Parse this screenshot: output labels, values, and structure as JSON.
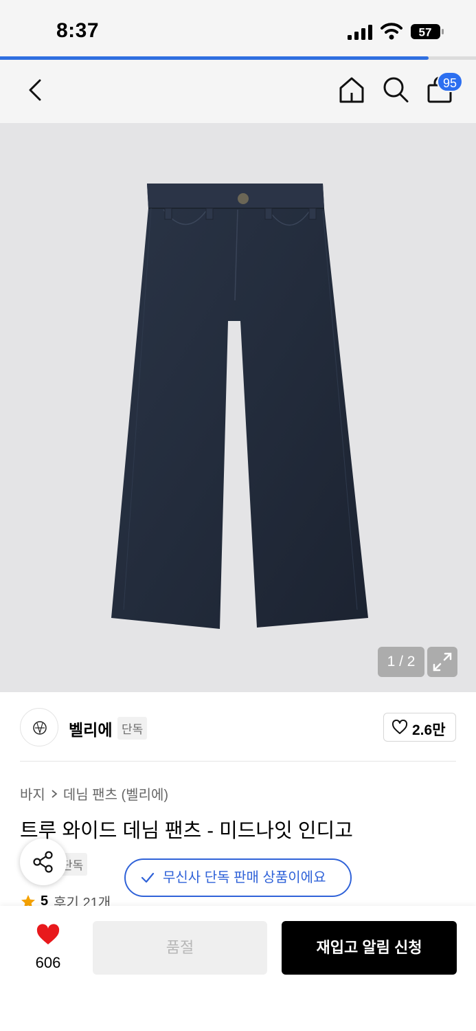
{
  "status_bar": {
    "time": "8:37",
    "battery": "57"
  },
  "page_progress": 0.9,
  "header": {
    "cart_count": "95"
  },
  "gallery": {
    "counter": "1 / 2"
  },
  "brand": {
    "name": "벨리에",
    "tag": "단독",
    "likes": "2.6만"
  },
  "breadcrumb": {
    "category": "바지",
    "subcategory": "데님 팬츠 (벨리에)"
  },
  "product": {
    "title": "트루 와이드 데님 팬츠 - 미드나잇 인디고",
    "tag": "단독",
    "rating": "5",
    "reviews": "후기 21개"
  },
  "toast": {
    "text": "무신사 단독 판매 상품이에요"
  },
  "bottom_bar": {
    "wish_count": "606",
    "soldout_label": "품절",
    "restock_label": "재입고 알림 신청"
  },
  "colors": {
    "accent": "#2f62d8",
    "heart": "#e8191c",
    "badge": "#2c6ff0",
    "star": "#f5a200"
  }
}
